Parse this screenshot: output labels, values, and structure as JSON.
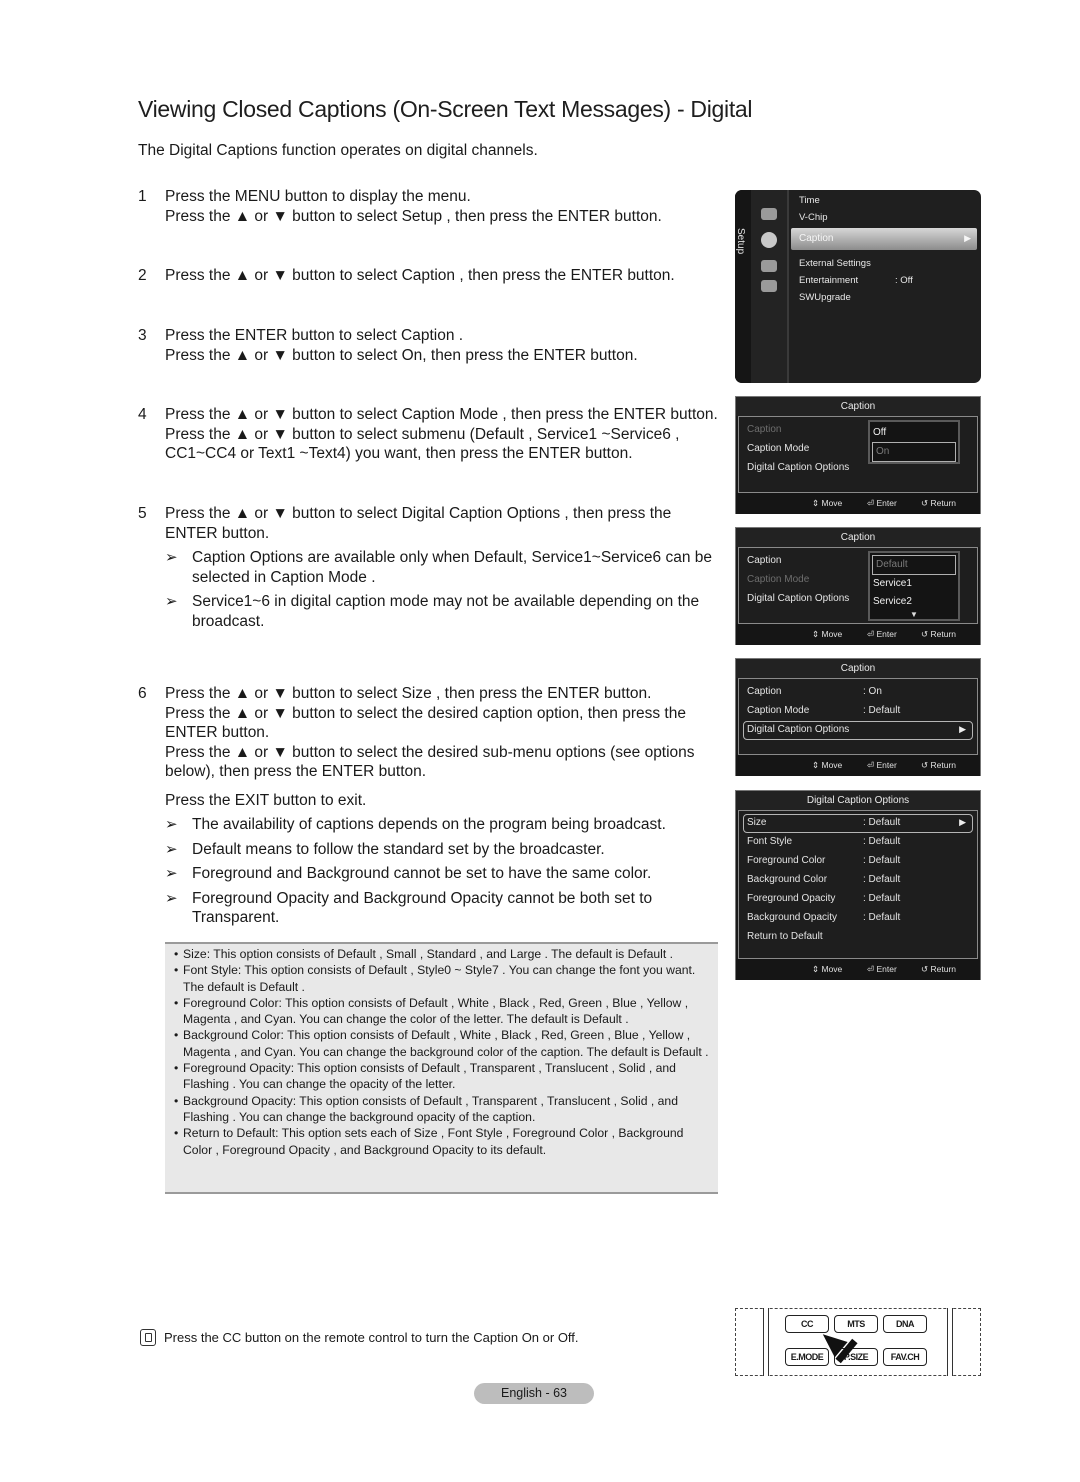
{
  "page": {
    "title": "Viewing Closed Captions (On-Screen Text Messages) - Digital",
    "intro": "The Digital Captions function operates on digital channels."
  },
  "steps": [
    {
      "num": "1",
      "lines": [
        "Press the MENU button to display the menu.",
        "Press the ▲ or ▼ button to select Setup , then press the ENTER button."
      ]
    },
    {
      "num": "2",
      "lines": [
        "Press the ▲ or ▼ button to select Caption , then press the ENTER button."
      ]
    },
    {
      "num": "3",
      "lines": [
        "Press the ENTER button to select Caption .",
        "Press the ▲ or ▼ button to select On, then press the ENTER button."
      ]
    },
    {
      "num": "4",
      "lines": [
        "Press the ▲ or ▼ button to select Caption Mode , then press the ENTER button.",
        "Press the ▲ or ▼ button to select submenu (Default , Service1 ~Service6 ,",
        "CC1~CC4 or Text1 ~Text4) you want, then press the ENTER button."
      ]
    },
    {
      "num": "5",
      "lines": [
        "Press the ▲ or ▼ button to select Digital Caption Options , then press the",
        "ENTER button."
      ],
      "notes": [
        "Caption Options are available only when Default, Service1~Service6 can be selected in Caption Mode .",
        "Service1~6 in digital caption mode may not be available depending on the broadcast."
      ]
    },
    {
      "num": "6",
      "lines": [
        "Press the ▲ or ▼ button to select Size , then press the ENTER button.",
        "Press the ▲ or ▼ button to select the desired caption option, then press the",
        "ENTER button.",
        "Press the ▲ or ▼ button to select the desired sub-menu options (see options",
        "below), then press the ENTER button."
      ],
      "exit": "Press the EXIT button to exit.",
      "notes": [
        "The availability of captions depends on the program being broadcast.",
        "Default means to follow the standard set by the broadcaster.",
        "Foreground and Background cannot be set to have the same color.",
        "Foreground Opacity and Background Opacity cannot be both set to Transparent."
      ]
    }
  ],
  "note_arrow": "➢",
  "options_box": [
    "Size: This option consists of Default , Small , Standard , and Large . The default is Default .",
    "Font Style: This option consists of Default , Style0 ~ Style7 . You can change the font you want. The default is Default .",
    "Foreground Color: This option consists of Default , White , Black , Red, Green , Blue , Yellow , Magenta , and Cyan. You can change the color of the letter. The default is Default .",
    "Background Color: This option consists of Default , White , Black , Red, Green , Blue , Yellow , Magenta , and Cyan. You can change the background color of the caption. The default is Default .",
    "Foreground Opacity: This option consists of Default , Transparent , Translucent , Solid , and Flashing . You can change the opacity of the letter.",
    "Background Opacity: This option consists of Default , Transparent , Translucent , Solid , and Flashing . You can change the background opacity of the caption.",
    "Return to Default: This option sets each of Size , Font Style , Foreground Color , Background Color , Foreground Opacity , and Background Opacity to its default."
  ],
  "bullet": "•",
  "setup_menu": {
    "side_label": "Setup",
    "items": [
      "Time",
      "V-Chip",
      "Caption",
      "External Settings",
      "Entertainment",
      "SWUpgrade"
    ],
    "entertainment_value": ": Off",
    "selected": "Caption",
    "arrow": "▶"
  },
  "footer_hints": {
    "move": "⇕ Move",
    "enter": "⏎ Enter",
    "return": "↺ Return"
  },
  "panel1": {
    "title": "Caption",
    "rows": [
      "Caption",
      "Caption Mode",
      "Digital Caption Options"
    ],
    "dropdown": [
      "Off",
      "On"
    ],
    "colon": ":"
  },
  "panel2": {
    "title": "Caption",
    "rows": [
      "Caption",
      "Caption Mode",
      "Digital Caption Options"
    ],
    "dropdown": [
      "Default",
      "Service1",
      "Service2"
    ],
    "more": "▼",
    "colon": ":"
  },
  "panel3": {
    "title": "Caption",
    "rows": [
      {
        "label": "Caption",
        "value": ": On"
      },
      {
        "label": "Caption Mode",
        "value": ": Default"
      },
      {
        "label": "Digital Caption Options",
        "value": ""
      }
    ],
    "arrow": "▶"
  },
  "panel4": {
    "title": "Digital Caption Options",
    "rows": [
      {
        "label": "Size",
        "value": ": Default"
      },
      {
        "label": "Font Style",
        "value": ": Default"
      },
      {
        "label": "Foreground Color",
        "value": ": Default"
      },
      {
        "label": "Background Color",
        "value": ": Default"
      },
      {
        "label": "Foreground Opacity",
        "value": ": Default"
      },
      {
        "label": "Background Opacity",
        "value": ": Default"
      },
      {
        "label": "Return to Default",
        "value": ""
      }
    ],
    "arrow": "▶"
  },
  "remote": {
    "buttons": [
      "CC",
      "MTS",
      "DNA",
      "E.MODE",
      "P.SIZE",
      "FAV.CH"
    ]
  },
  "cc_note": "Press the CC button on the remote control to turn the Caption On or Off.",
  "page_number": "English - 63"
}
